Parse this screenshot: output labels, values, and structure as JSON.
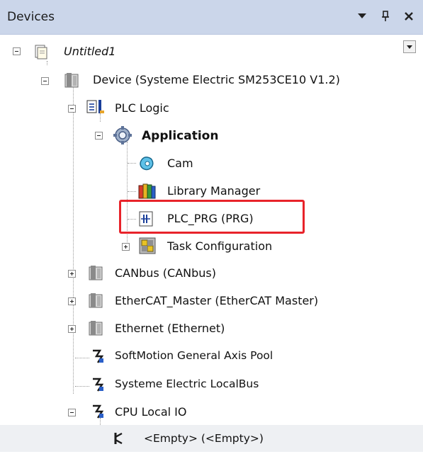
{
  "panel": {
    "title": "Devices",
    "buttons": [
      "dropdown",
      "pin",
      "close"
    ]
  },
  "tree": {
    "project": "Untitled1",
    "device": "Device (Systeme Electric SM253CE10 V1.2)",
    "plc_logic": "PLC Logic",
    "application": "Application",
    "cam": "Cam",
    "library_manager": "Library Manager",
    "plc_prg": "PLC_PRG (PRG)",
    "task_configuration": "Task Configuration",
    "canbus": "CANbus (CANbus)",
    "ethercat": "EtherCAT_Master (EtherCAT Master)",
    "ethernet": "Ethernet (Ethernet)",
    "softmotion": "SoftMotion General Axis Pool",
    "localbus": "Systeme Electric LocalBus",
    "cpu_io": "CPU Local IO",
    "empty": "<Empty> (<Empty>)"
  },
  "highlight_color": "#e8232a"
}
